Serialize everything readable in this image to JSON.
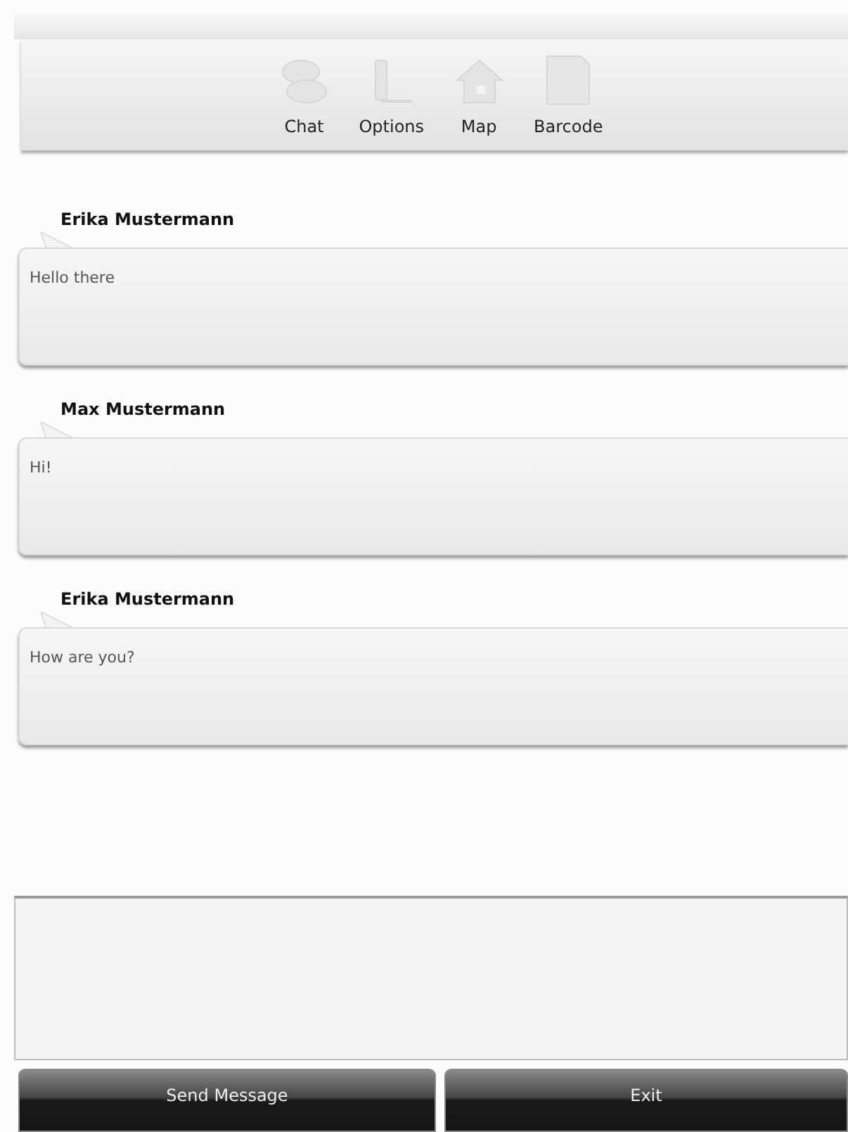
{
  "toolbar": {
    "items": [
      {
        "kind": "chat",
        "label": "Chat"
      },
      {
        "kind": "options",
        "label": "Options"
      },
      {
        "kind": "map",
        "label": "Map"
      },
      {
        "kind": "barcode",
        "label": "Barcode"
      }
    ]
  },
  "messages": [
    {
      "sender": "Erika Mustermann",
      "text": "Hello there"
    },
    {
      "sender": "Max Mustermann",
      "text": "Hi!"
    },
    {
      "sender": "Erika Mustermann",
      "text": "How are you?"
    }
  ],
  "buttons": [
    {
      "label": "Send Message"
    },
    {
      "label": "Exit"
    }
  ]
}
